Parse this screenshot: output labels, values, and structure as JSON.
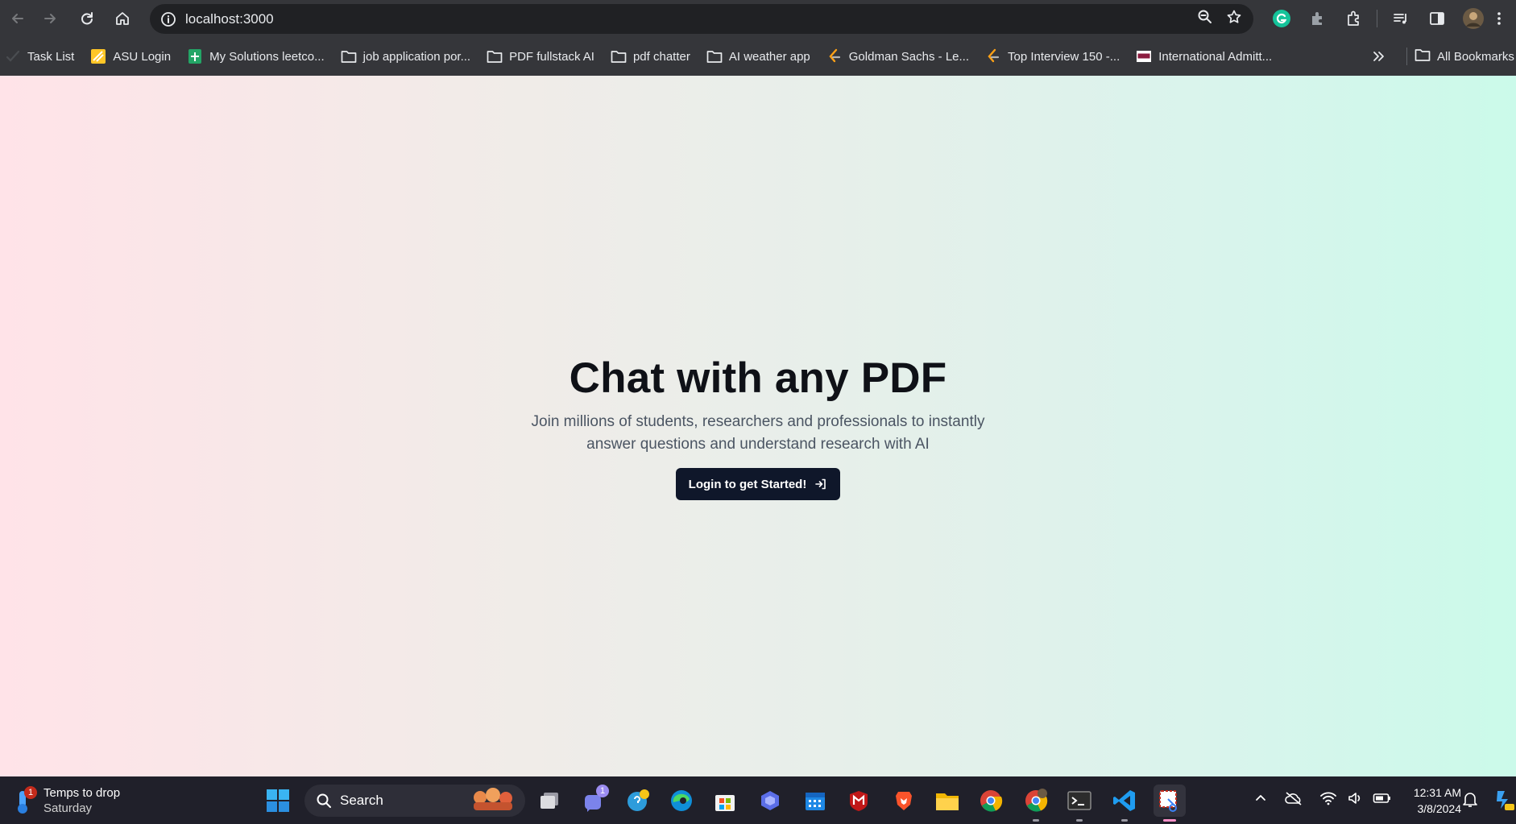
{
  "browser": {
    "url": "localhost:3000",
    "bookmarks": [
      {
        "label": "Task List",
        "icon": "check-icon"
      },
      {
        "label": "ASU Login",
        "icon": "asu-icon"
      },
      {
        "label": "My Solutions leetco...",
        "icon": "sheets-icon"
      },
      {
        "label": "job application por...",
        "icon": "folder-icon"
      },
      {
        "label": "PDF fullstack AI",
        "icon": "folder-icon"
      },
      {
        "label": "pdf chatter",
        "icon": "folder-icon"
      },
      {
        "label": "AI weather app",
        "icon": "folder-icon"
      },
      {
        "label": "Goldman Sachs - Le...",
        "icon": "leetcode-icon"
      },
      {
        "label": "Top Interview 150 -...",
        "icon": "leetcode-icon"
      },
      {
        "label": "International Admitt...",
        "icon": "asu-logo-icon"
      }
    ],
    "all_bookmarks": "All Bookmarks"
  },
  "hero": {
    "title": "Chat with any PDF",
    "subtitle": "Join millions of students, researchers and professionals to instantly answer questions and understand research with AI",
    "cta_label": "Login to get Started!"
  },
  "taskbar": {
    "weather_title": "Temps to drop",
    "weather_sub": "Saturday",
    "weather_badge": "1",
    "search_label": "Search",
    "teams_badge": "1",
    "time": "12:31 AM",
    "date": "3/8/2024"
  },
  "colors": {
    "cta_bg": "#0f172a",
    "title_text": "#0f1117",
    "gradient_left": "#ffe3e8",
    "gradient_right": "#cbfaea"
  }
}
